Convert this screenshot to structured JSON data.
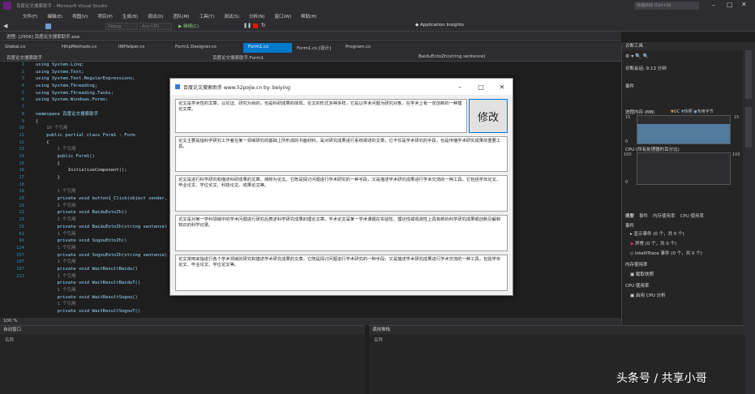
{
  "window": {
    "title": "百度论文搜索助手 - Microsoft Visual Studio",
    "quick_launch": "快速启动 (Ctrl+Q)"
  },
  "menu": [
    "文件(F)",
    "编辑(E)",
    "视图(V)",
    "项目(P)",
    "生成(B)",
    "调试(D)",
    "团队(M)",
    "工具(T)",
    "测试(S)",
    "分析(N)",
    "窗口(W)",
    "帮助(H)"
  ],
  "toolbar": {
    "debug_config": "Debug",
    "platform": "Any CPU",
    "start_label": "继续(C)",
    "insights": "Application Insights"
  },
  "process": "进程: [2956] 百度论文搜索助手.exe",
  "tabs": [
    {
      "label": "Global.cs",
      "active": false
    },
    {
      "label": "HttpMethods.cs",
      "active": false
    },
    {
      "label": "IWHelper.cs",
      "active": false
    },
    {
      "label": "Form1.Designer.cs",
      "active": false
    },
    {
      "label": "Form1.cs",
      "active": true
    },
    {
      "label": "Form1.cs [设计]",
      "active": false
    },
    {
      "label": "Program.cs",
      "active": false
    }
  ],
  "nav": {
    "project": "百度论文搜索助手",
    "class": "百度论文搜索助手.Form1",
    "member": "BaiduEntoZh(string sentence)"
  },
  "editor": {
    "line_numbers": [
      "1",
      "2",
      "3",
      "4",
      "5",
      "6",
      "7",
      "8",
      "9",
      "10",
      "11",
      "12",
      "13",
      "14",
      "15",
      "16",
      "17",
      "18",
      "19",
      "20",
      "21",
      "22",
      "23",
      "25",
      "61",
      "99",
      "124",
      "157",
      "187",
      "197",
      "213"
    ],
    "lines": [
      "using System.Linq;",
      "using System.Text;",
      "using System.Text.RegularExpressions;",
      "using System.Threading;",
      "using System.Threading.Tasks;",
      "using System.Windows.Forms;",
      "",
      "namespace 百度论文搜索助手",
      "{",
      "    10 个引用",
      "    public partial class Form1 : Form",
      "    {",
      "        1 个引用",
      "        public Form1()",
      "        {",
      "            InitializeComponent();",
      "        }",
      "",
      "        1 个引用",
      "        private void button1_Click(object sender, EventArgs e)",
      "        1 个引用",
      "        private void BaiduEntoZh()",
      "        1 个引用",
      "        private void BaiduEntoZh(string sentence)",
      "        1 个引用",
      "        private void SogouEntoZh()",
      "        1 个引用",
      "        private void SogouEntoZh(string sentence)",
      "        1 个引用",
      "        private void WaitResultBaidu()",
      "        1 个引用",
      "        private void WaitResultBaiduT()",
      "        1 个引用",
      "        private void WaitResultSogou()",
      "        1 个引用",
      "        private void WaitResultSogouT()"
    ],
    "zoom": "100 %"
  },
  "form": {
    "title": "百度论文搜索助手 www.52pojie.cn by: beiying",
    "button": "修改",
    "paragraphs": [
      "论文是学术性的文章，以论证、研究为目的，也是科研成果的体现。论文的形式多种多样，它是以学术问题为研究对象，在学术上有一定创新的一种理论文章。",
      "论文主要是指科学研究工作者在某一领域研究的基础上所形成的书面材料，是对研究成果进行系统阐述的文章，它不仅是学术研究的手段，也是传播学术研究成果的重要工具。",
      "论文是进行科学研究和描述科研成果的文章，简称为论文。它既是探讨问题进行学术研究的一种手段，又是描述学术研究成果进行学术交流的一种工具。它包括学年论文、毕业论文、学位论文、科技论文、成果论文等。",
      "论文是对某一学科领域中的学术问题进行研究后表述科学研究成果的理论文章。学术论文是某一学术课题在实验性、理论性或观测性上具有新的科学研究成果或创新见解和知识的科学记录。",
      "论文常用来指进行各个学术领域的研究和描述学术研究成果的文章，它既是探讨问题进行学术研究的一种手段，又是描述学术研究成果进行学术交流的一种工具，包括学年论文、毕业论文、学位论文等。"
    ]
  },
  "diagnostics": {
    "title": "诊断工具",
    "session": "诊断会话: 9:13 分钟",
    "events": "事件",
    "memory": "进程内存 (MB)",
    "legend": [
      "GC",
      "快照",
      "专用字节"
    ],
    "mem_max": "15",
    "mem_min": "0",
    "cpu": "CPU (所有处理器的百分比)",
    "cpu_max": "100",
    "cpu_min": "0",
    "subtabs": [
      "摘要",
      "事件",
      "内存使用率",
      "CPU 使用率"
    ],
    "items": [
      "显示事件 (0 个，共 0 个)",
      "异常 (0 个，共 0 个)",
      "IntelliTrace 事件 (0 个，共 0 个)"
    ],
    "memory_section": "内存使用率",
    "snapshot": "截取快照",
    "cpu_section": "CPU 使用率",
    "cpu_profile": "启用 CPU 分析"
  },
  "panels": {
    "left": "自动窗口",
    "right": "调用堆栈",
    "left_col": "名称",
    "right_col": "名称"
  },
  "watermark": "头条号 / 共享小哥",
  "colors": {
    "accent": "#007acc",
    "editor_bg": "#1e1e1e",
    "chrome": "#2d2d30"
  }
}
